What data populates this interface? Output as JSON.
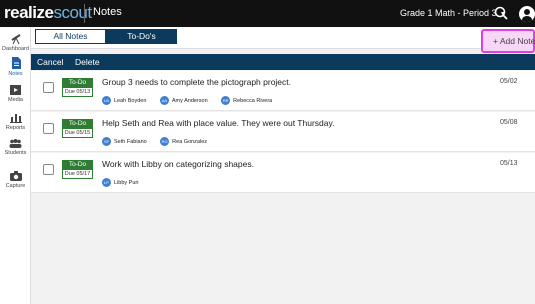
{
  "app": {
    "brand_part1": "realize",
    "brand_part2": "scout",
    "section": "Notes",
    "class_selector": "Grade 1 Math - Period 3"
  },
  "sidebar": {
    "items": [
      {
        "label": "Dashboard",
        "icon": "telescope-icon"
      },
      {
        "label": "Notes",
        "icon": "notes-icon"
      },
      {
        "label": "Media",
        "icon": "media-icon"
      },
      {
        "label": "Reports",
        "icon": "reports-icon"
      },
      {
        "label": "Students",
        "icon": "students-icon"
      },
      {
        "label": "Capture",
        "icon": "camera-icon"
      }
    ]
  },
  "tabs": {
    "all": "All Notes",
    "todo": "To-Do's"
  },
  "add_note": "+ Add Note",
  "actions": {
    "cancel": "Cancel",
    "delete": "Delete"
  },
  "notes": [
    {
      "badge": "To-Do",
      "due": "Due 05/13",
      "text": "Group 3 needs to complete the pictograph project.",
      "date": "05/02",
      "people": [
        {
          "initials": "LB",
          "name": "Leah Boyden"
        },
        {
          "initials": "AA",
          "name": "Amy Anderson"
        },
        {
          "initials": "RR",
          "name": "Rebecca Rivera"
        }
      ]
    },
    {
      "badge": "To-Do",
      "due": "Due 05/15",
      "text": "Help Seth and Rea with place value. They were out Thursday.",
      "date": "05/08",
      "people": [
        {
          "initials": "SF",
          "name": "Seth Fabiano"
        },
        {
          "initials": "RG",
          "name": "Rea Gonzalez"
        }
      ]
    },
    {
      "badge": "To-Do",
      "due": "Due 05/17",
      "text": "Work with Libby on categorizing shapes.",
      "date": "05/13",
      "people": [
        {
          "initials": "LP",
          "name": "Libby Puri"
        }
      ]
    }
  ]
}
